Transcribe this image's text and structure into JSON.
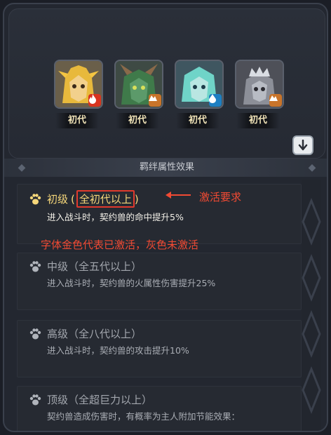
{
  "pets": [
    {
      "generation": "初代",
      "element_icon": "fire-icon",
      "element_color": "#d8341f",
      "portrait": "gold-hair-hero"
    },
    {
      "generation": "初代",
      "element_icon": "earth-icon",
      "element_color": "#c9742a",
      "portrait": "green-horned-demon"
    },
    {
      "generation": "初代",
      "element_icon": "water-icon",
      "element_color": "#1e7fc2",
      "portrait": "teal-hair-spirit"
    },
    {
      "generation": "初代",
      "element_icon": "earth-icon",
      "element_color": "#c9742a",
      "portrait": "silver-crowned-beast"
    }
  ],
  "expand_button_icon": "arrow-down-icon",
  "section_title": "羁绊属性效果",
  "tiers": [
    {
      "name": "初级",
      "requirement": "（全初代以上）",
      "requirement_text": "全初代以上",
      "description": "进入战斗时，契约兽的命中提升5%",
      "active": true
    },
    {
      "name": "中级",
      "requirement": "（全五代以上）",
      "description": "进入战斗时，契约兽的火属性伤害提升25%",
      "active": false
    },
    {
      "name": "高级",
      "requirement": "（全八代以上）",
      "description": "进入战斗时，契约兽的攻击提升10%",
      "active": false
    },
    {
      "name": "顶级",
      "requirement": "（全超巨力以上）",
      "description": "契约兽造成伤害时，有概率为主人附加节能效果：",
      "active": false
    }
  ],
  "annotations": {
    "activation_requirement": "激活要求",
    "color_explanation": "字体金色代表已激活，灰色未激活"
  },
  "colors": {
    "active_gold": "#f6d77a",
    "inactive_grey": "#a3a7ae",
    "annotation_red": "#f14a33"
  }
}
